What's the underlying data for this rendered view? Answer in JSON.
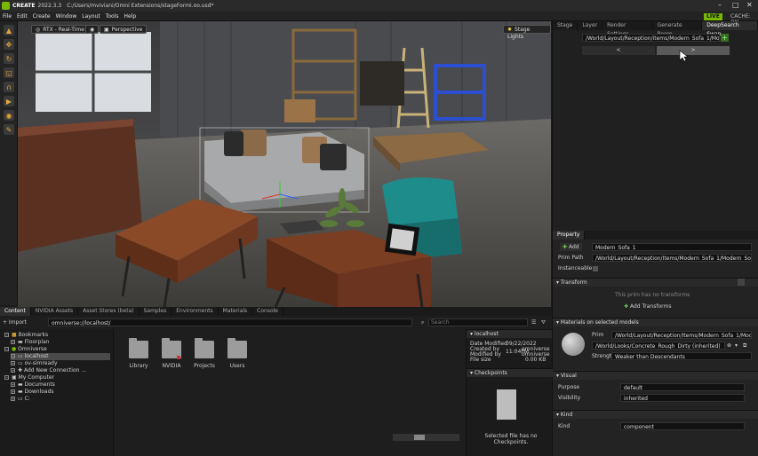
{
  "titlebar": {
    "app": "CREATE",
    "version": "2022.3.3",
    "path": "C:/Users/mviviani/Omni Extensions/stageFormi.oo.usd*",
    "min": "–",
    "max": "□",
    "close": "✕"
  },
  "menu": [
    "File",
    "Edit",
    "Create",
    "Window",
    "Layout",
    "Tools",
    "Help"
  ],
  "status": {
    "live": "LIVE",
    "cache": "CACHE: ON"
  },
  "viewport": {
    "renderer": "RTX - Real-Time",
    "camera": "Perspective",
    "lights": "Stage Lights"
  },
  "right_tabs": [
    "Stage",
    "Layer",
    "Render Settings",
    "Generate Room",
    "DeepSearch Swap"
  ],
  "deepsearch": {
    "path": "/World/Layout/Reception/items/Modern_Sofa_1/Modern_Sofa_",
    "prev": "<",
    "next": ">"
  },
  "property": {
    "tab": "Property",
    "add": "Add",
    "name": "Modern_Sofa_1",
    "prim_path_label": "Prim Path",
    "prim_path": "/World/Layout/Reception/Items/Modern_Sofa_1/Modern_Sofa_1",
    "instanceable_label": "Instanceable",
    "transform_h": "Transform",
    "no_transforms": "This prim has no transforms",
    "add_transforms": "Add Transforms",
    "materials_h": "Materials on selected models",
    "prim_label": "Prim",
    "prim_value": "/World/Layout/Reception/Items/Modern_Sofa_1/Modern_Sofa",
    "material_value": "/World/Looks/Concrete_Rough_Dirty (inherited)",
    "strength_label": "Strength",
    "strength_value": "Weaker than Descendants",
    "visual_h": "Visual",
    "purpose_label": "Purpose",
    "purpose_value": "default",
    "visibility_label": "Visibility",
    "visibility_value": "inherited",
    "kind_h": "Kind",
    "kind_label": "Kind",
    "kind_value": "component"
  },
  "bottom_tabs": [
    "Content",
    "NVIDIA Assets",
    "Asset Stores (beta)",
    "Samples",
    "Environments",
    "Materials",
    "Console"
  ],
  "content": {
    "import": "+ Import",
    "path": "omniverse://localhost/",
    "search_placeholder": "Search",
    "tree": [
      "Bookmarks",
      "Floorplan",
      "Omniverse",
      "localhost",
      "ov-simready",
      "Add New Connection ...",
      "My Computer",
      "Documents",
      "Downloads",
      "C:"
    ],
    "folders": [
      "Library",
      "NVIDIA",
      "Projects",
      "Users"
    ],
    "info": {
      "title": "localhost",
      "date_label": "Date Modified",
      "date": "09/22/2022 11:04PM",
      "created_label": "Created by",
      "created": "omniverse",
      "modified_label": "Modified by",
      "modified": "omniverse",
      "size_label": "File size",
      "size": "0.00 KB",
      "checkpoints": "Checkpoints",
      "no_checkpoints": "Selected file has no Checkpoints."
    }
  }
}
